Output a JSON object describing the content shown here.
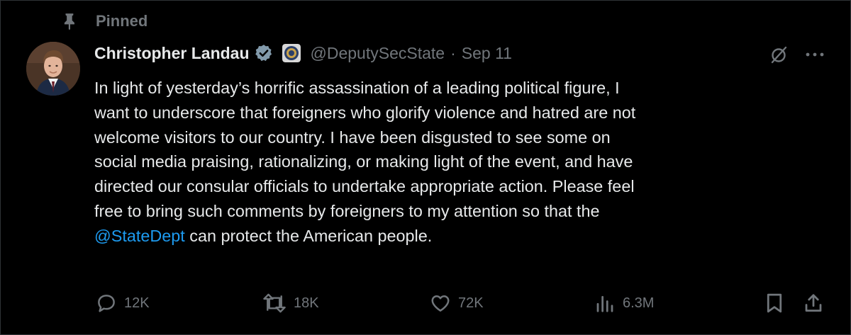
{
  "pinned_label": "Pinned",
  "author": {
    "name": "Christopher Landau",
    "handle": "@DeputySecState",
    "separator": "·",
    "date": "Sep 11"
  },
  "tweet": {
    "lines": [
      "In light of yesterday’s horrific assassination of a leading political figure, I",
      "want to underscore that foreigners who glorify violence and hatred are not",
      "welcome visitors to our country. I have been disgusted to see some on",
      "social media praising, rationalizing, or making light of the event, and have",
      "directed our consular officials to undertake appropriate action. Please feel",
      "free to bring such comments by foreigners to my attention so that the"
    ],
    "last_line_mention": "@StateDept",
    "last_line_rest": " can protect the American people."
  },
  "actions": {
    "replies": "12K",
    "reposts": "18K",
    "likes": "72K",
    "views": "6.3M"
  },
  "icons": {
    "pin": "pin-icon",
    "verified": "verified-badge-icon",
    "affiliation": "state-department-seal-icon",
    "grok": "grok-icon",
    "more": "more-options-icon",
    "reply": "reply-icon",
    "repost": "repost-icon",
    "like": "like-icon",
    "views": "views-icon",
    "bookmark": "bookmark-icon",
    "share": "share-icon"
  },
  "colors": {
    "background": "#000000",
    "text": "#e7e9ea",
    "secondary": "#71767b",
    "link": "#1d9bf0",
    "verified_badge": "#829aab"
  }
}
